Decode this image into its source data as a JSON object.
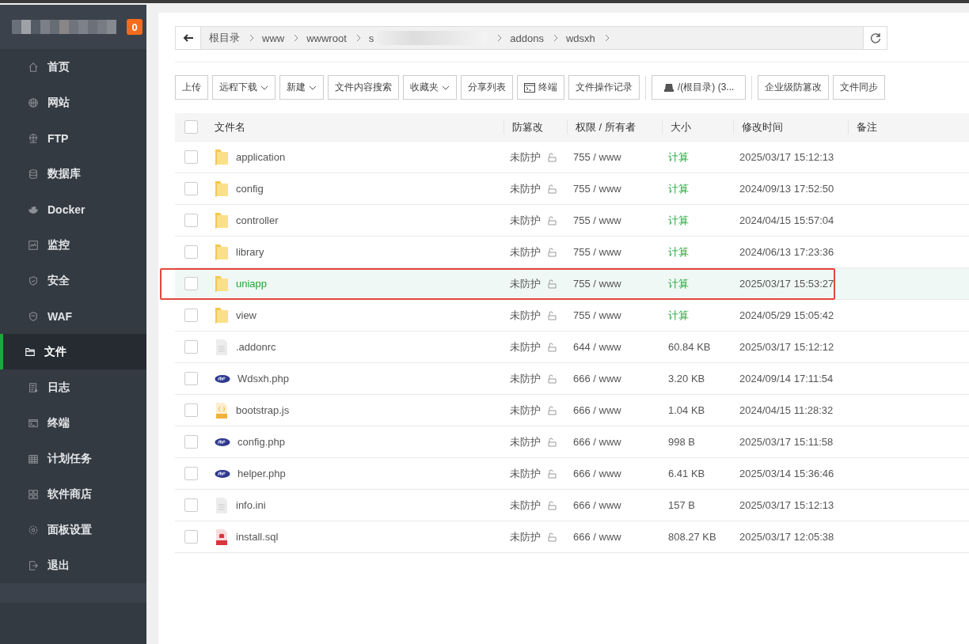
{
  "sidebar": {
    "badge": "0",
    "items": [
      {
        "label": "首页",
        "selected": false
      },
      {
        "label": "网站",
        "selected": false
      },
      {
        "label": "FTP",
        "selected": false
      },
      {
        "label": "数据库",
        "selected": false
      },
      {
        "label": "Docker",
        "selected": false
      },
      {
        "label": "监控",
        "selected": false
      },
      {
        "label": "安全",
        "selected": false
      },
      {
        "label": "WAF",
        "selected": false
      },
      {
        "label": "文件",
        "selected": true
      },
      {
        "label": "日志",
        "selected": false
      },
      {
        "label": "终端",
        "selected": false
      },
      {
        "label": "计划任务",
        "selected": false
      },
      {
        "label": "软件商店",
        "selected": false
      },
      {
        "label": "面板设置",
        "selected": false
      },
      {
        "label": "退出",
        "selected": false
      }
    ]
  },
  "breadcrumb": [
    "根目录",
    "www",
    "wwwroot",
    "s",
    "addons",
    "wdsxh"
  ],
  "toolbar": [
    {
      "label": "上传",
      "kind": "plain"
    },
    {
      "label": "远程下载",
      "kind": "dropdown"
    },
    {
      "label": "新建",
      "kind": "dropdown"
    },
    {
      "label": "文件内容搜索",
      "kind": "plain"
    },
    {
      "label": "收藏夹",
      "kind": "dropdown"
    },
    {
      "label": "分享列表",
      "kind": "plain"
    },
    {
      "label": "终端",
      "kind": "terminal"
    },
    {
      "label": "文件操作记录",
      "kind": "plain"
    },
    {
      "label": "/(根目录) (3...",
      "kind": "disk"
    },
    {
      "label": "企业级防篡改",
      "kind": "plain"
    },
    {
      "label": "文件同步",
      "kind": "plain"
    }
  ],
  "table": {
    "all_checked": false,
    "columns": [
      "文件名",
      "防篡改",
      "权限 / 所有者",
      "大小",
      "修改时间",
      "备注"
    ],
    "rows": [
      {
        "name": "application",
        "kind": "folder",
        "protect": "未防护",
        "perm": "755 / www",
        "size": "计算",
        "size_link": true,
        "time": "2025/03/17 15:12:13",
        "selected": false,
        "annotated": false
      },
      {
        "name": "config",
        "kind": "folder",
        "protect": "未防护",
        "perm": "755 / www",
        "size": "计算",
        "size_link": true,
        "time": "2024/09/13 17:52:50",
        "selected": false,
        "annotated": false
      },
      {
        "name": "controller",
        "kind": "folder",
        "protect": "未防护",
        "perm": "755 / www",
        "size": "计算",
        "size_link": true,
        "time": "2024/04/15 15:57:04",
        "selected": false,
        "annotated": false
      },
      {
        "name": "library",
        "kind": "folder",
        "protect": "未防护",
        "perm": "755 / www",
        "size": "计算",
        "size_link": true,
        "time": "2024/06/13 17:23:36",
        "selected": false,
        "annotated": false
      },
      {
        "name": "uniapp",
        "kind": "folder",
        "protect": "未防护",
        "perm": "755 / www",
        "size": "计算",
        "size_link": true,
        "time": "2025/03/17 15:53:27",
        "selected": true,
        "annotated": true
      },
      {
        "name": "view",
        "kind": "folder",
        "protect": "未防护",
        "perm": "755 / www",
        "size": "计算",
        "size_link": true,
        "time": "2024/05/29 15:05:42",
        "selected": false,
        "annotated": false
      },
      {
        "name": ".addonrc",
        "kind": "text",
        "protect": "未防护",
        "perm": "644 / www",
        "size": "60.84 KB",
        "size_link": false,
        "time": "2025/03/17 15:12:12",
        "selected": false,
        "annotated": false
      },
      {
        "name": "Wdsxh.php",
        "kind": "php",
        "protect": "未防护",
        "perm": "666 / www",
        "size": "3.20 KB",
        "size_link": false,
        "time": "2024/09/14 17:11:54",
        "selected": false,
        "annotated": false
      },
      {
        "name": "bootstrap.js",
        "kind": "js",
        "protect": "未防护",
        "perm": "666 / www",
        "size": "1.04 KB",
        "size_link": false,
        "time": "2024/04/15 11:28:32",
        "selected": false,
        "annotated": false
      },
      {
        "name": "config.php",
        "kind": "php",
        "protect": "未防护",
        "perm": "666 / www",
        "size": "998 B",
        "size_link": false,
        "time": "2025/03/17 15:11:58",
        "selected": false,
        "annotated": false
      },
      {
        "name": "helper.php",
        "kind": "php",
        "protect": "未防护",
        "perm": "666 / www",
        "size": "6.41 KB",
        "size_link": false,
        "time": "2025/03/14 15:36:46",
        "selected": false,
        "annotated": false
      },
      {
        "name": "info.ini",
        "kind": "text",
        "protect": "未防护",
        "perm": "666 / www",
        "size": "157 B",
        "size_link": false,
        "time": "2025/03/17 15:12:13",
        "selected": false,
        "annotated": false
      },
      {
        "name": "install.sql",
        "kind": "sql",
        "protect": "未防护",
        "perm": "666 / www",
        "size": "808.27 KB",
        "size_link": false,
        "time": "2025/03/17 12:05:38",
        "selected": false,
        "annotated": false
      }
    ]
  }
}
